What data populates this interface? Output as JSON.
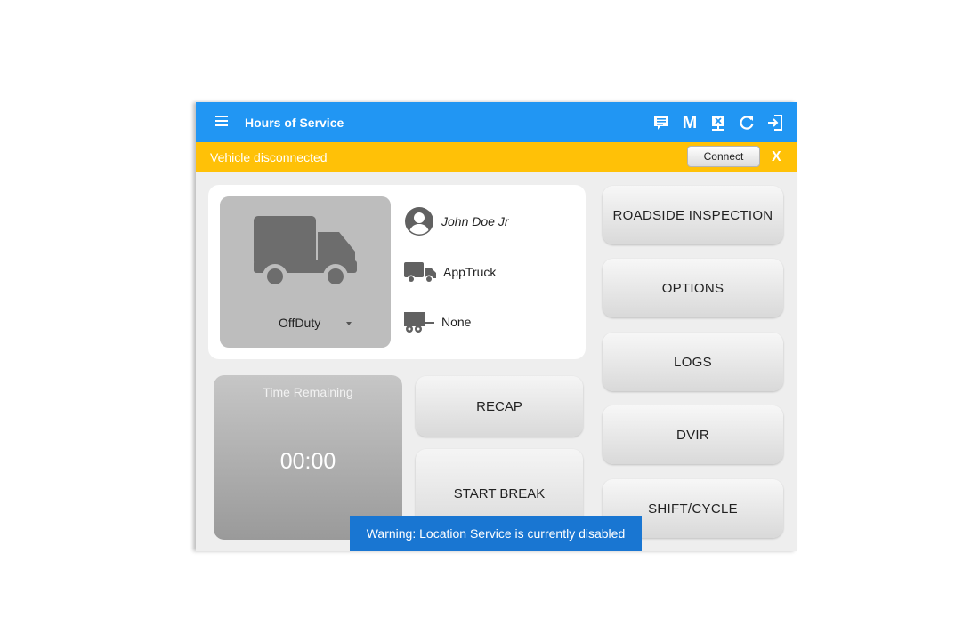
{
  "app_bar": {
    "title": "Hours of Service",
    "menu_icon": "hamburger-menu-icon",
    "actions": [
      {
        "icon": "message-icon"
      },
      {
        "icon": "m-icon",
        "label": "M"
      },
      {
        "icon": "sync-status-icon"
      },
      {
        "icon": "refresh-icon"
      },
      {
        "icon": "logout-icon"
      }
    ]
  },
  "banner": {
    "text": "Vehicle disconnected",
    "connect_label": "Connect",
    "close_label": "X",
    "color": "#ffc107"
  },
  "driver_card": {
    "status": "OffDuty",
    "driver_name": "John Doe Jr",
    "vehicle": "AppTruck",
    "trailer": "None"
  },
  "time_remaining": {
    "label": "Time Remaining",
    "value": "00:00"
  },
  "middle_buttons": {
    "recap": "RECAP",
    "start_break": "START BREAK"
  },
  "side_buttons": {
    "roadside": "ROADSIDE INSPECTION",
    "options": "OPTIONS",
    "logs": "LOGS",
    "dvir": "DVIR",
    "shift_cycle": "SHIFT/CYCLE"
  },
  "toast": {
    "text": "Warning: Location Service is currently disabled"
  },
  "colors": {
    "primary": "#2196f3",
    "toast": "#1976d2"
  }
}
